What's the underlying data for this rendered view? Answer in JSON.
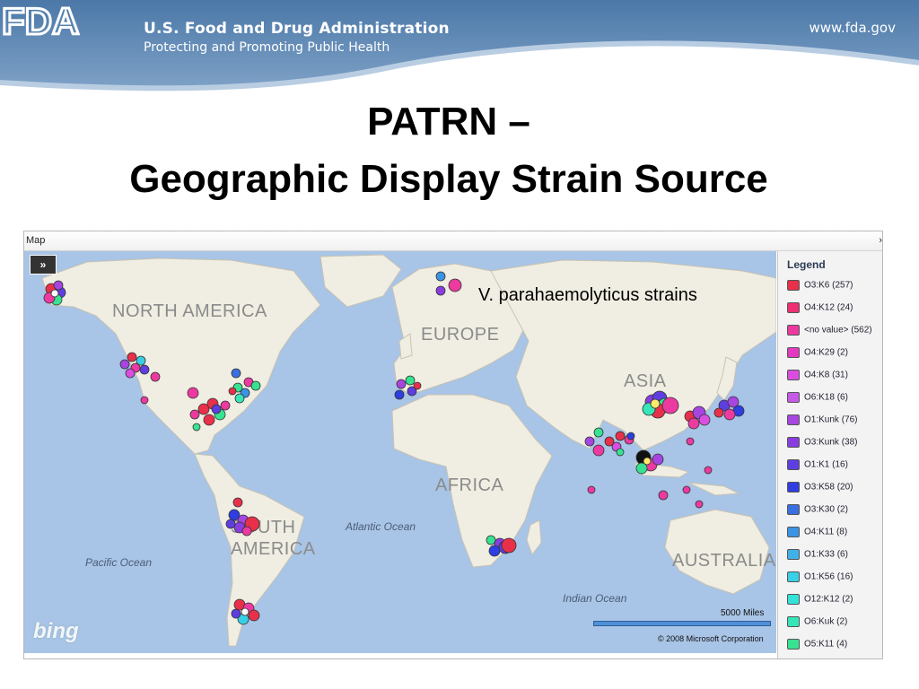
{
  "header": {
    "logo_text": "FDA",
    "agency_name": "U.S. Food and Drug Administration",
    "tagline": "Protecting and Promoting Public Health",
    "url": "www.fda.gov"
  },
  "title": {
    "line1": "PATRN –",
    "line2": "Geographic Display Strain Source"
  },
  "panel": {
    "title": "Map",
    "expand_glyph": "›"
  },
  "map": {
    "nav_toggle": "»",
    "overlay_text": "V. parahaemolyticus strains",
    "continents": [
      "NORTH AMERICA",
      "EUROPE",
      "ASIA",
      "AFRICA",
      "SOUTH AMERICA",
      "AUSTRALIA"
    ],
    "oceans": [
      "Pacific Ocean",
      "Atlantic Ocean",
      "Indian Ocean"
    ],
    "provider_logo": "bing",
    "scale_label": "5000 Miles",
    "copyright": "© 2008 Microsoft Corporation"
  },
  "legend": {
    "title": "Legend",
    "items": [
      {
        "label": "O3:K6 (257)",
        "color": "#e8304a"
      },
      {
        "label": "O4:K12 (24)",
        "color": "#ef2f74"
      },
      {
        "label": "<no value> (562)",
        "color": "#ec3aa0"
      },
      {
        "label": "O4:K29 (2)",
        "color": "#e23ac0"
      },
      {
        "label": "O4:K8 (31)",
        "color": "#d94ee0"
      },
      {
        "label": "O6:K18 (6)",
        "color": "#c65ae6"
      },
      {
        "label": "O1:Kunk (76)",
        "color": "#a645e0"
      },
      {
        "label": "O3:Kunk (38)",
        "color": "#8a3ddf"
      },
      {
        "label": "O1:K1 (16)",
        "color": "#5f3ee0"
      },
      {
        "label": "O3:K58 (20)",
        "color": "#2e3ee0"
      },
      {
        "label": "O3:K30 (2)",
        "color": "#3a6fe0"
      },
      {
        "label": "O4:K11 (8)",
        "color": "#3b93e4"
      },
      {
        "label": "O1:K33 (6)",
        "color": "#3fb1e8"
      },
      {
        "label": "O1:K56 (16)",
        "color": "#39cfe4"
      },
      {
        "label": "O12:K12 (2)",
        "color": "#34e2d8"
      },
      {
        "label": "O6:Kuk (2)",
        "color": "#36e6b8"
      },
      {
        "label": "O5:K11 (4)",
        "color": "#37e290"
      }
    ]
  }
}
